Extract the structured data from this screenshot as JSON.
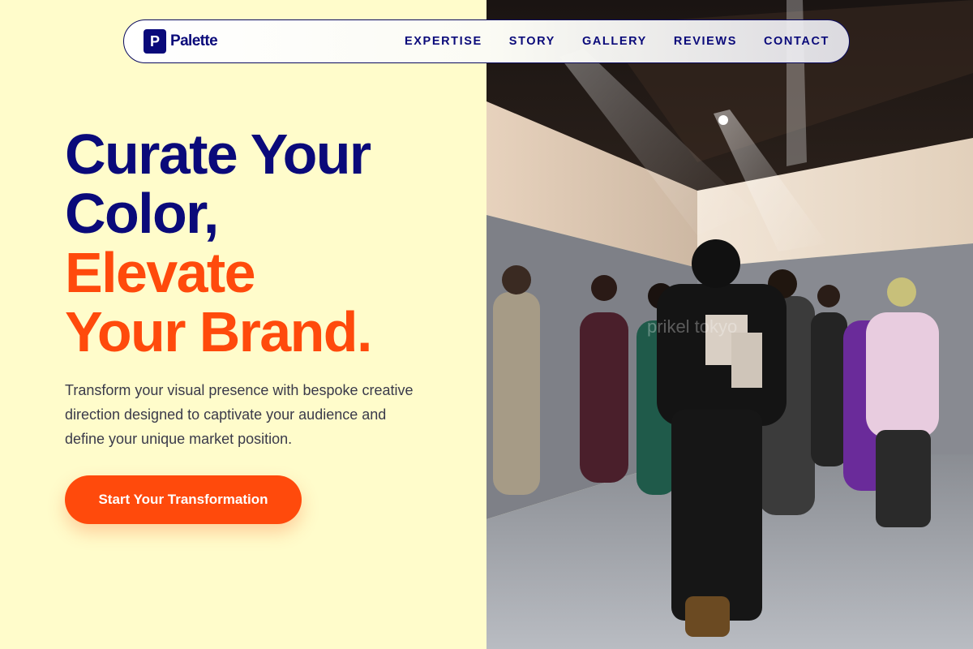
{
  "brand": {
    "logo_letter": "P",
    "name": "Palette"
  },
  "nav": {
    "items": [
      "EXPERTISE",
      "STORY",
      "GALLERY",
      "REVIEWS",
      "CONTACT"
    ]
  },
  "hero": {
    "title_line1": "Curate Your",
    "title_line2": "Color,",
    "title_line3": "Elevate",
    "title_line4": "Your Brand.",
    "subtitle": "Transform your visual presence with bespoke creative direction designed to captivate your audience and define your unique market position.",
    "cta_label": "Start Your Transformation"
  },
  "photo": {
    "watermark": "prikel tokyo"
  },
  "colors": {
    "navy": "#0A0A7A",
    "orange": "#FF4A0C",
    "background": "#FFFCCB"
  }
}
